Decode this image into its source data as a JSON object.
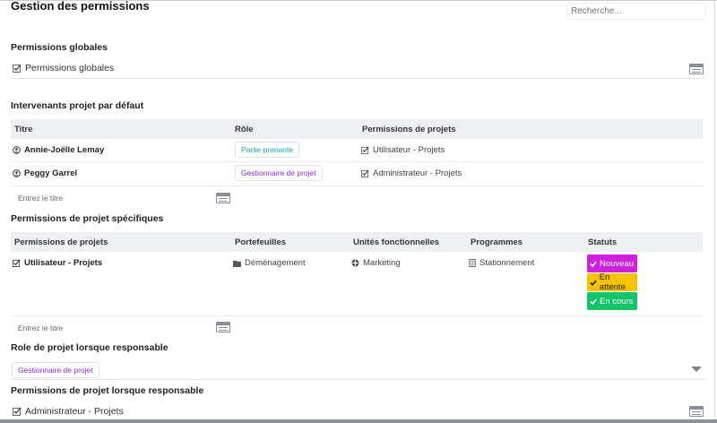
{
  "page": {
    "title": "Gestion des permissions"
  },
  "search": {
    "placeholder": "Recherche..."
  },
  "global_permissions": {
    "heading": "Permissions globales",
    "value": "Permissions globales"
  },
  "default_stakeholders": {
    "heading": "Intervenants projet par défaut",
    "columns": [
      "Titre",
      "Rôle",
      "Permissions de projets"
    ],
    "rows": [
      {
        "name": "Annie-Joëlle Lemay",
        "role": "Partie prenante",
        "permission": "Utilisateur - Projets"
      },
      {
        "name": "Peggy Garrel",
        "role": "Gestionnaire de projet",
        "permission": "Administrateur - Projets"
      }
    ],
    "input_placeholder": "Entrez le titre"
  },
  "specific_permissions": {
    "heading": "Permissions de projet spécifiques",
    "columns": [
      "Permissions de projets",
      "Portefeuilles",
      "Unités fonctionnelles",
      "Programmes",
      "Statuts"
    ],
    "rows": [
      {
        "permission": "Utilisateur - Projets",
        "portfolio": "Déménagement",
        "unit": "Marketing",
        "program": "Stationnement",
        "statuses": [
          {
            "label": "Nouveau",
            "color": "#cc22dd"
          },
          {
            "label": "En attente",
            "color": "#f5c200"
          },
          {
            "label": "En cours",
            "color": "#12c46a"
          }
        ]
      }
    ],
    "input_placeholder": "Entrez le titre"
  },
  "responsible_role": {
    "heading": "Role de projet lorsque responsable",
    "value": "Gestionnaire de projet"
  },
  "responsible_permissions": {
    "heading": "Permissions de projet lorsque responsable",
    "value": "Administrateur - Projets"
  },
  "icons": {
    "checkbox": "check-square-icon",
    "user": "user-circle-icon",
    "folder": "folder-icon",
    "unit": "org-unit-icon",
    "program": "program-icon",
    "list": "list-icon",
    "dropdown": "caret-down-icon"
  }
}
